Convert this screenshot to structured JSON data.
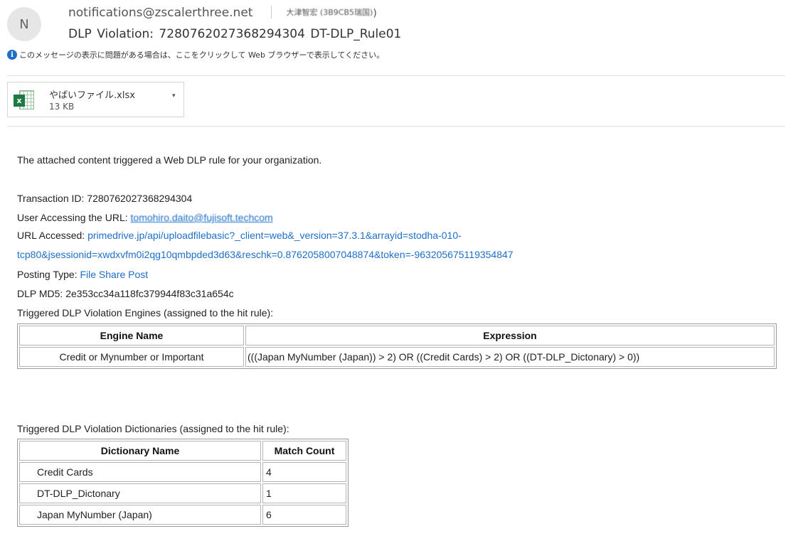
{
  "header": {
    "avatar_letter": "N",
    "from": "notifications@zscalerthree.net",
    "to_blurred": "大津智宏 (3B9CB5瑞国)",
    "to_tail": ")",
    "subject": "DLP Violation:  7280762027368294304   DT-DLP_Rule01",
    "info_icon": "i",
    "info_text": "このメッセージの表示に問題がある場合は、ここをクリックして Web ブラウザーで表示してください。"
  },
  "attachment": {
    "icon": "excel-file-icon",
    "icon_letter": "x",
    "name": "やばいファイル.xlsx",
    "size": "13 KB",
    "caret": "▾"
  },
  "body": {
    "intro": "The attached content triggered a Web DLP rule for your organization.",
    "transaction_label": "Transaction ID: ",
    "transaction_id": "7280762027368294304",
    "user_label": "User Accessing the URL: ",
    "user_value": "tomohiro.daito@fujisoft.techcom",
    "url_label": "URL Accessed: ",
    "url_line1": "primedrive.jp/api/uploadfilebasic?_client=web&_version=37.3.1&arrayid=stodha-010-",
    "url_line2": "tcp80&jsessionid=xwdxvfm0i2qg10qmbpded3d63&reschk=0.8762058007048874&token=-963205675119354847",
    "posting_label": "Posting Type: ",
    "posting_value": "File Share Post",
    "md5_label": "DLP MD5: ",
    "md5_value": "2e353cc34a118fc379944f83c31a654c",
    "engines_heading": "Triggered DLP Violation Engines (assigned to the hit rule):",
    "dictionaries_heading": "Triggered DLP Violation Dictionaries (assigned to the hit rule):"
  },
  "engines_table": {
    "headers": [
      "Engine Name",
      "Expression"
    ],
    "rows": [
      [
        "Credit or Mynumber or Important",
        "(((Japan MyNumber (Japan)) > 2) OR ((Credit Cards) > 2) OR ((DT-DLP_Dictonary) > 0))"
      ]
    ]
  },
  "dictionaries_table": {
    "headers": [
      "Dictionary Name",
      "Match Count"
    ],
    "rows": [
      [
        "Credit Cards",
        "4"
      ],
      [
        "DT-DLP_Dictonary",
        "1"
      ],
      [
        "Japan MyNumber (Japan)",
        "6"
      ]
    ]
  }
}
